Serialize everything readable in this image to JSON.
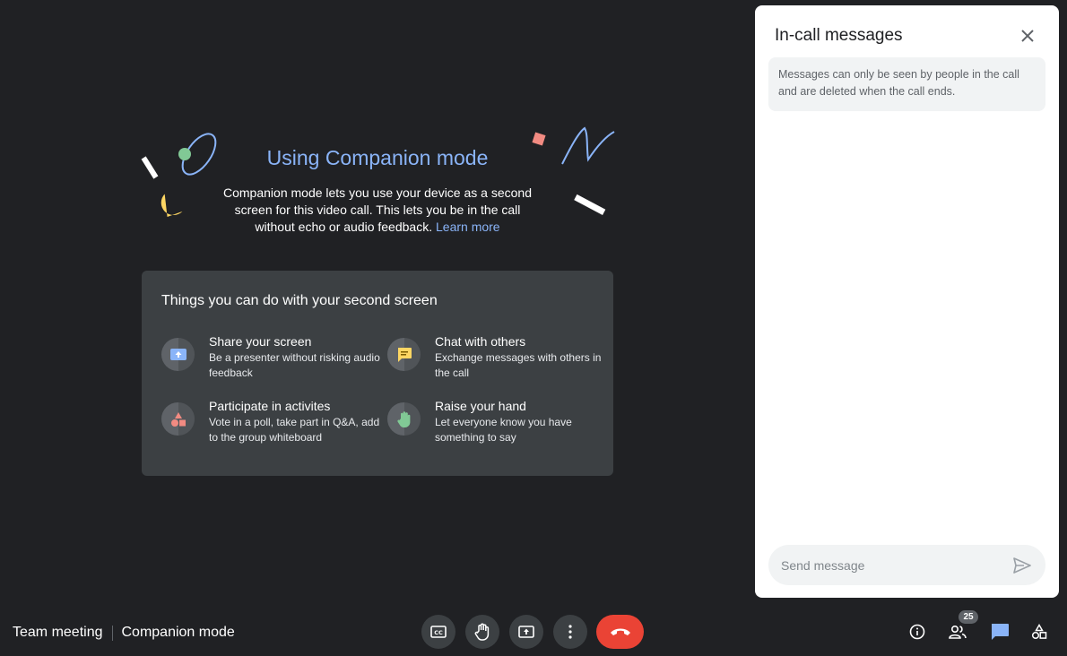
{
  "companion": {
    "title": "Using Companion mode",
    "description": "Companion mode lets you use your device as a second screen for this video call. This lets you be in the call without echo or audio feedback.",
    "learn_more": "Learn more"
  },
  "card": {
    "title": "Things you can do with your second screen",
    "features": [
      {
        "title": "Share your screen",
        "desc": "Be a presenter without risking audio feedback",
        "icon": "present-screen-icon"
      },
      {
        "title": "Chat with others",
        "desc": "Exchange messages with others in the call",
        "icon": "chat-icon"
      },
      {
        "title": "Participate in activites",
        "desc": "Vote in a poll, take part in Q&A, add to the group whiteboard",
        "icon": "shapes-icon"
      },
      {
        "title": "Raise your hand",
        "desc": "Let everyone know you have something to say",
        "icon": "hand-icon"
      }
    ]
  },
  "panel": {
    "title": "In-call messages",
    "note": "Messages can only be seen by people in the call and are deleted when the call ends.",
    "input_placeholder": "Send message"
  },
  "footer": {
    "meeting_name": "Team meeting",
    "mode": "Companion mode",
    "participant_count": "25"
  },
  "colors": {
    "background": "#202124",
    "accent": "#8ab4f8",
    "end_call": "#ea4335",
    "chat_active": "#1a73e8"
  }
}
